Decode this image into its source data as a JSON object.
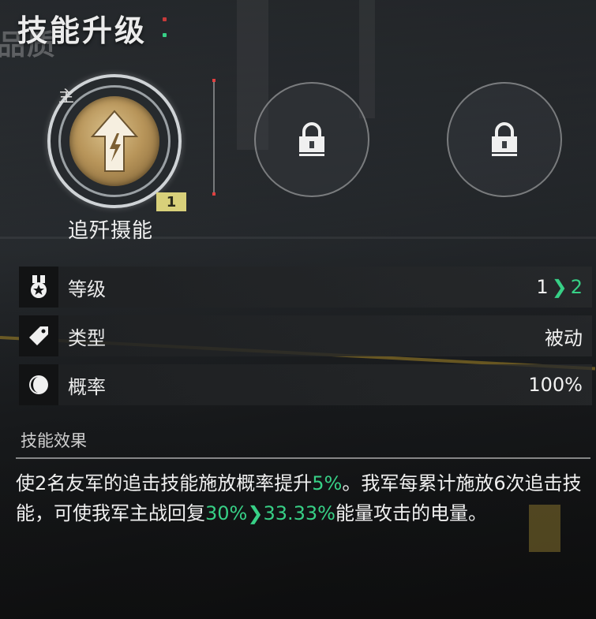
{
  "header": {
    "title": "技能升级",
    "ghost_text": "品质"
  },
  "main_skill": {
    "tag": "主",
    "level_badge": "1",
    "name": "追歼摄能",
    "icon": "arrow-up-lightning-icon"
  },
  "locked_slots": [
    {
      "icon": "lock-icon"
    },
    {
      "icon": "lock-icon"
    }
  ],
  "stats": [
    {
      "icon": "medal-icon",
      "label": "等级",
      "value_from": "1",
      "value_to": "2"
    },
    {
      "icon": "tag-icon",
      "label": "类型",
      "value": "被动"
    },
    {
      "icon": "moon-icon",
      "label": "概率",
      "value": "100%"
    }
  ],
  "effect": {
    "heading": "技能效果",
    "text_part1": "使2名友军的追击技能施放概率提升",
    "highlight1": "5%",
    "text_part2": "。我军每累计施放6次追击技能，可使我军主战回复",
    "highlight2_from": "30%",
    "highlight2_to": "33.33%",
    "text_part3": "能量攻击的电量。"
  },
  "colors": {
    "accent_green": "#37d086",
    "badge_yellow": "#d8d07a",
    "gold": "#b8955a"
  }
}
